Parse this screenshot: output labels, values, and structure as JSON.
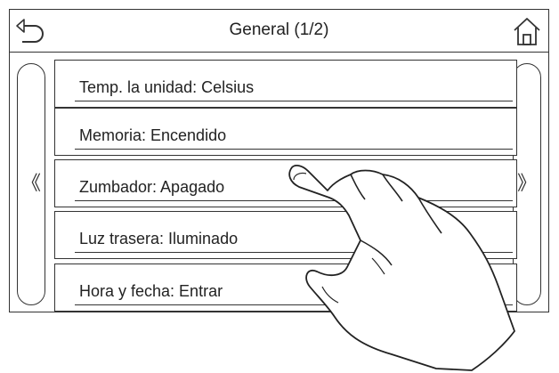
{
  "header": {
    "title": "General (1/2)",
    "back_icon": "back-arrow-icon",
    "home_icon": "home-icon"
  },
  "nav": {
    "prev_label": "《",
    "next_label": "》"
  },
  "menu": {
    "items": [
      {
        "label": "Temp. la unidad: Celsius"
      },
      {
        "label": "Memoria: Encendido"
      },
      {
        "label": "Zumbador: Apagado"
      },
      {
        "label": "Luz trasera: Iluminado"
      },
      {
        "label": "Hora y fecha: Entrar"
      }
    ]
  },
  "overlay": {
    "icon": "pointing-hand-icon"
  }
}
